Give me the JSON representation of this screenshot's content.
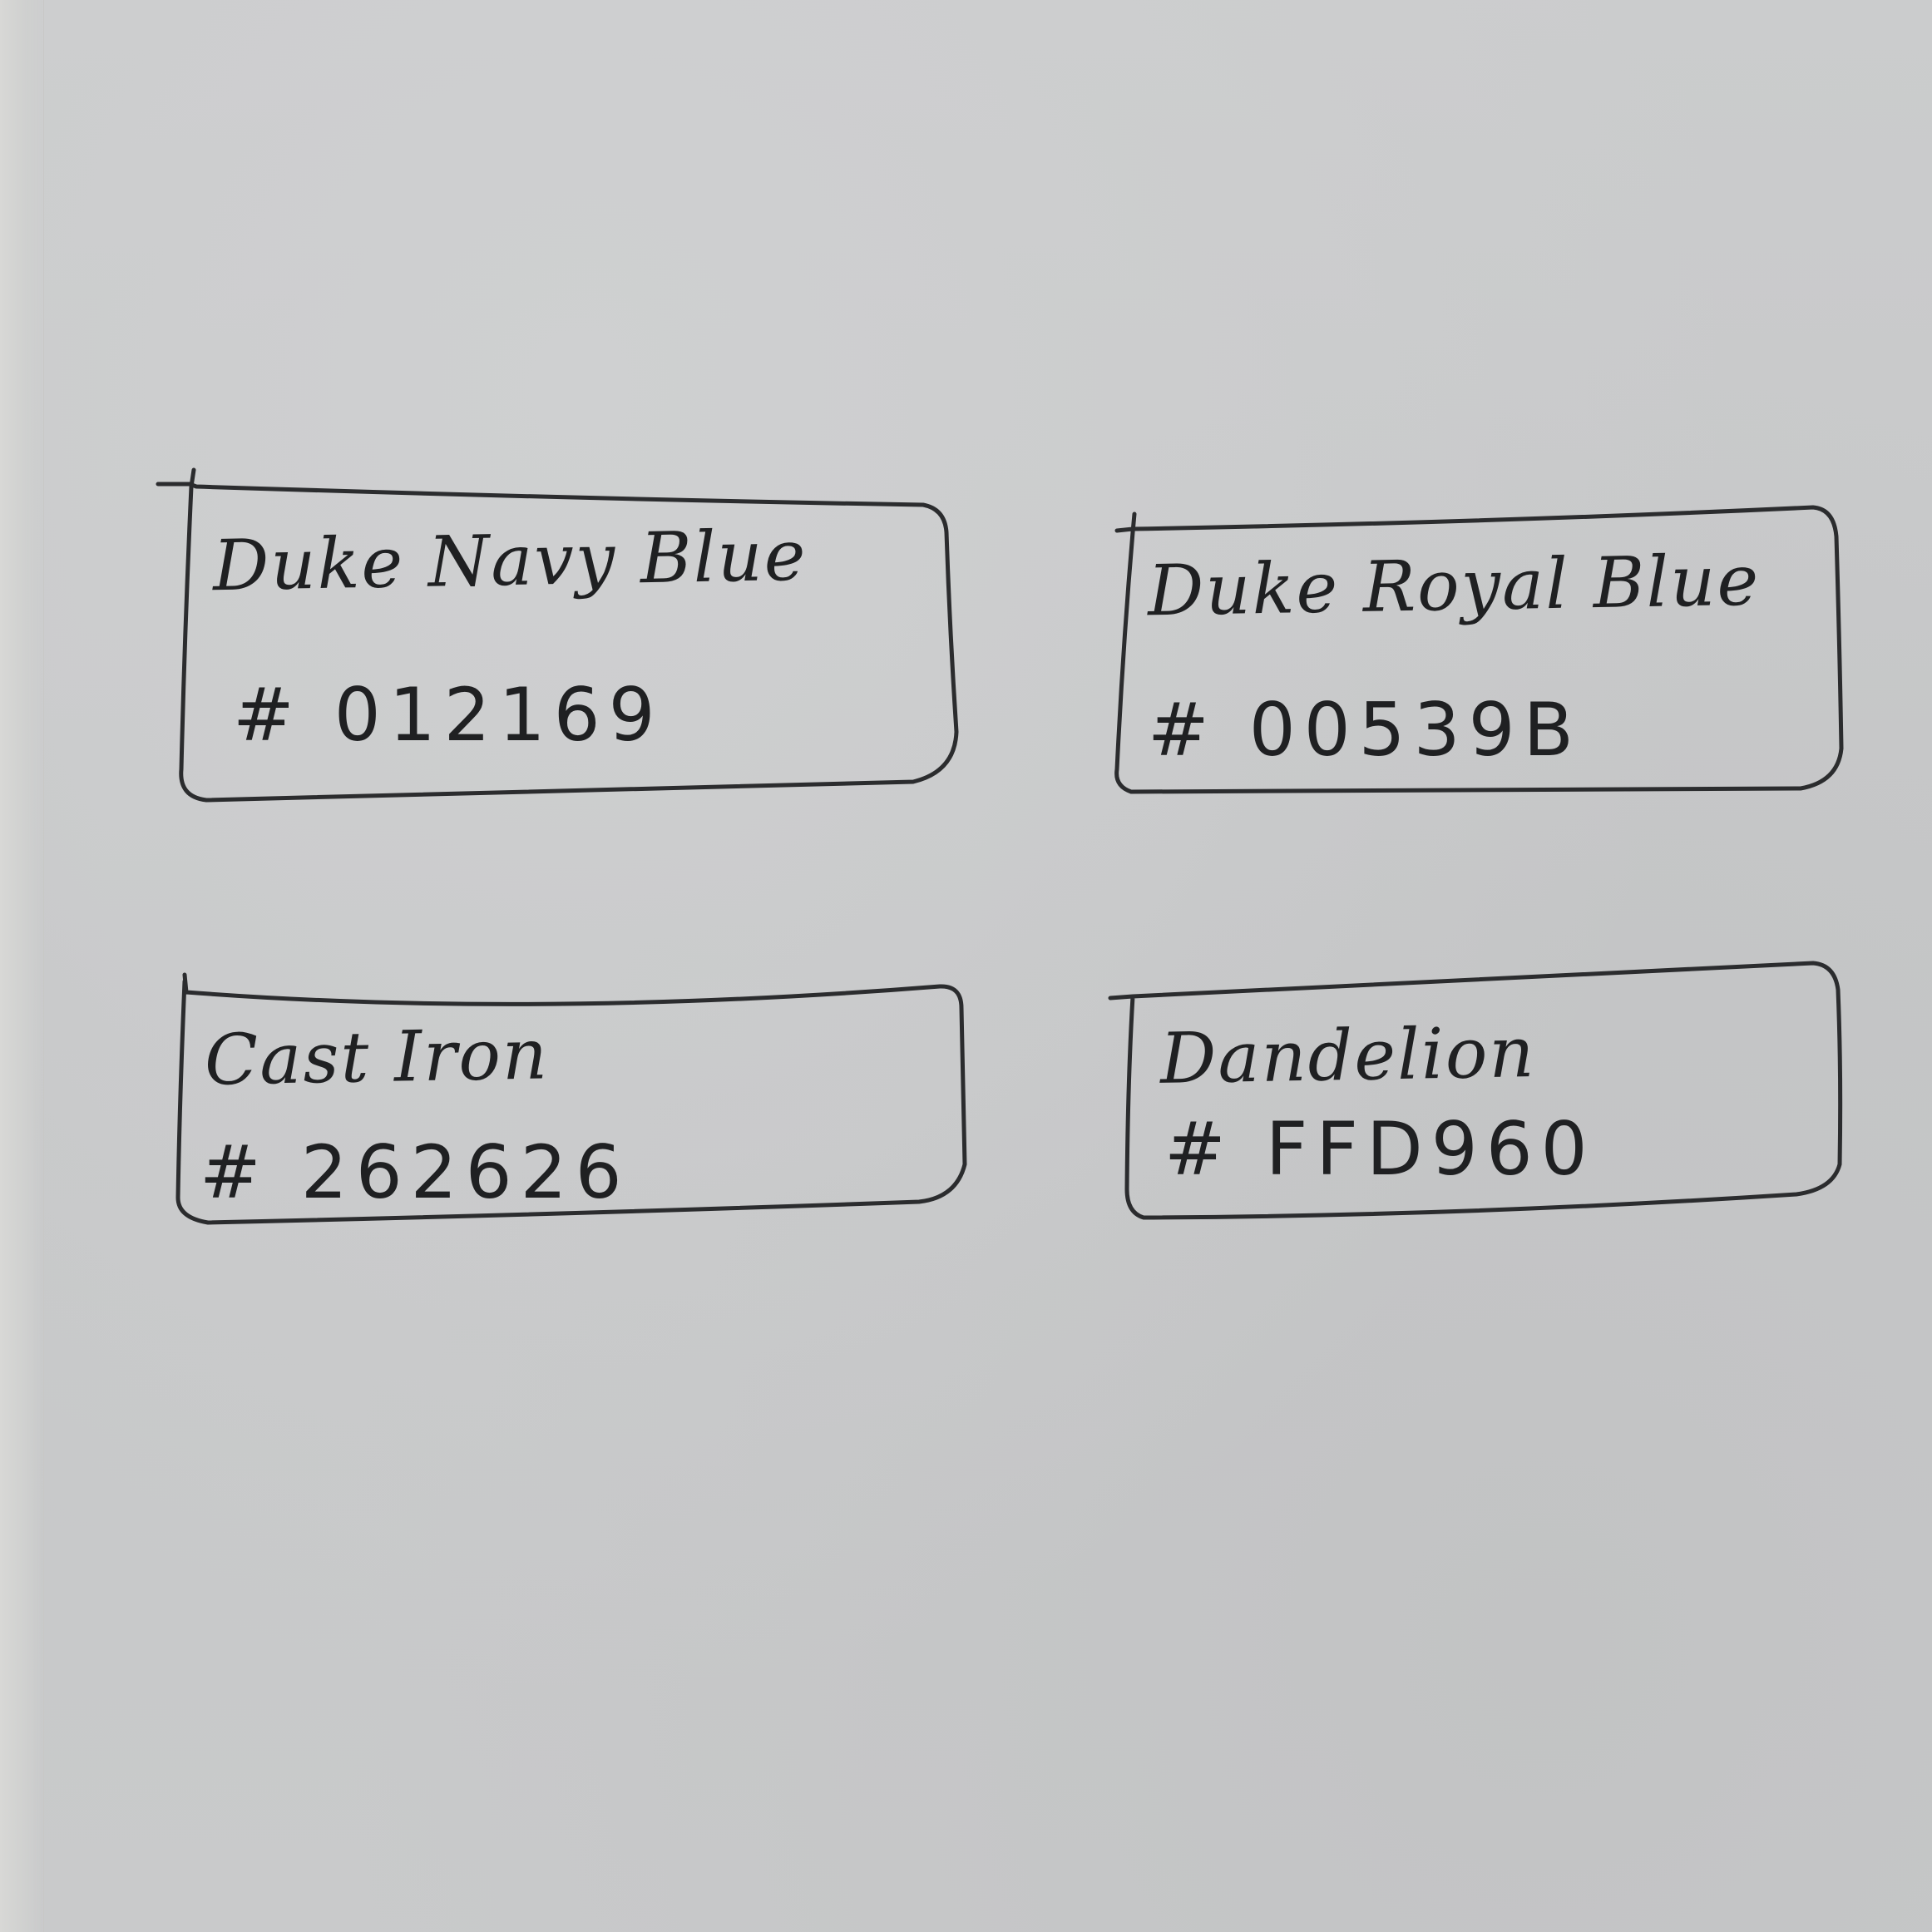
{
  "cards": [
    {
      "name": "Duke Navy Blue",
      "hex": "# 012169"
    },
    {
      "name": "Duke Royal Blue",
      "hex": "# 00539B"
    },
    {
      "name": "Cast Iron",
      "hex": "# 262626"
    },
    {
      "name": "Dandelion",
      "hex": "# FFD960"
    }
  ],
  "colors": {
    "paper": "#c9cacb",
    "pencil": "#2b2c2e"
  }
}
